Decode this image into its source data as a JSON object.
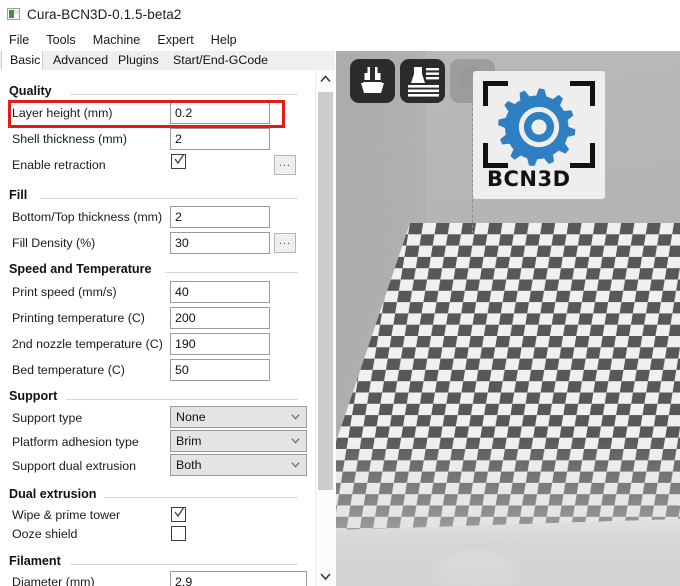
{
  "window": {
    "title": "Cura-BCN3D-0.1.5-beta2",
    "icon": "app-icon"
  },
  "menubar": {
    "items": [
      {
        "label": "File"
      },
      {
        "label": "Tools"
      },
      {
        "label": "Machine"
      },
      {
        "label": "Expert"
      },
      {
        "label": "Help"
      }
    ]
  },
  "tabs": [
    {
      "label": "Basic",
      "active": true
    },
    {
      "label": "Advanced",
      "active": false
    },
    {
      "label": "Plugins",
      "active": false
    },
    {
      "label": "Start/End-GCode",
      "active": false
    }
  ],
  "settings": {
    "groups": [
      {
        "title": "Quality",
        "rows": [
          {
            "label": "Layer height (mm)",
            "type": "text",
            "value": "0.2",
            "highlighted": true
          },
          {
            "label": "Shell thickness (mm)",
            "type": "text",
            "value": "2"
          },
          {
            "label": "Enable retraction",
            "type": "checkbox",
            "checked": true,
            "extra": "..."
          }
        ]
      },
      {
        "title": "Fill",
        "rows": [
          {
            "label": "Bottom/Top thickness (mm)",
            "type": "text",
            "value": "2"
          },
          {
            "label": "Fill Density (%)",
            "type": "text",
            "value": "30",
            "extra": "..."
          }
        ]
      },
      {
        "title": "Speed and Temperature",
        "rows": [
          {
            "label": "Print speed (mm/s)",
            "type": "text",
            "value": "40"
          },
          {
            "label": "Printing temperature (C)",
            "type": "text",
            "value": "200"
          },
          {
            "label": "2nd nozzle temperature (C)",
            "type": "text",
            "value": "190"
          },
          {
            "label": "Bed temperature (C)",
            "type": "text",
            "value": "50"
          }
        ]
      },
      {
        "title": "Support",
        "rows": [
          {
            "label": "Support type",
            "type": "select",
            "value": "None"
          },
          {
            "label": "Platform adhesion type",
            "type": "select",
            "value": "Brim"
          },
          {
            "label": "Support dual extrusion",
            "type": "select",
            "value": "Both"
          }
        ]
      },
      {
        "title": "Dual extrusion",
        "rows": [
          {
            "label": "Wipe & prime tower",
            "type": "checkbox",
            "checked": true
          },
          {
            "label": "Ooze shield",
            "type": "checkbox",
            "checked": false
          }
        ]
      },
      {
        "title": "Filament",
        "rows": [
          {
            "label": "Diameter (mm)",
            "type": "text",
            "value": "2.9"
          }
        ]
      }
    ]
  },
  "viewport": {
    "toolbar": [
      {
        "name": "load-model-button",
        "style": "dark"
      },
      {
        "name": "view-layers-button",
        "style": "dark"
      },
      {
        "name": "print-button",
        "style": "ghost"
      }
    ],
    "logo": {
      "text": "BCN3D",
      "gear_color": "#2f80c2",
      "bracket_color": "#121212"
    },
    "plate": {
      "checker_dark": "#585858",
      "checker_light": "#f0f0f0"
    },
    "background_color": "#b7b7b7"
  },
  "scrollbar": {
    "up_arrow": "chevron-up-icon",
    "down_arrow": "chevron-down-icon"
  },
  "highlight": {
    "color": "#e41b17"
  }
}
